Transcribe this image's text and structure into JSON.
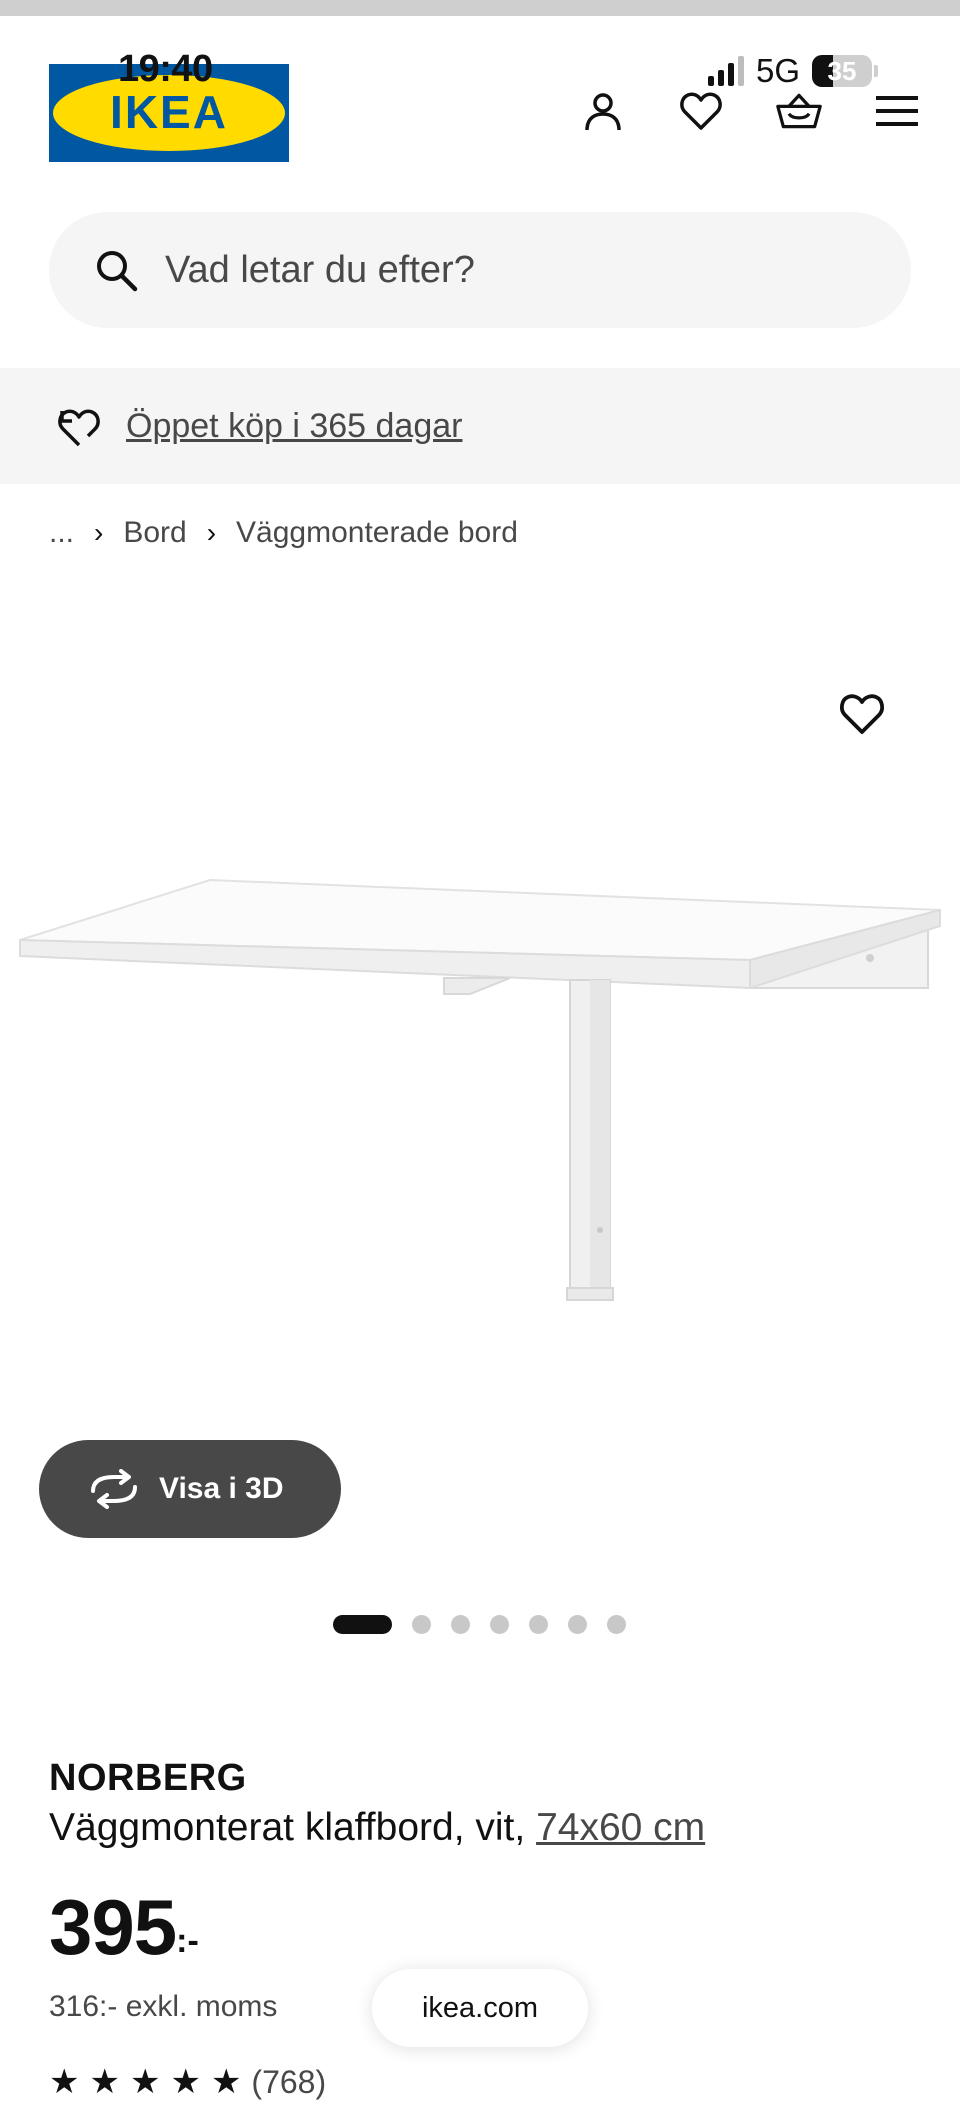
{
  "status_bar": {
    "time": "19:40",
    "network": "5G",
    "battery": "35",
    "battery_level": 35
  },
  "header": {
    "logo_text": "IKEA",
    "icons": [
      "user-icon",
      "heart-icon",
      "basket-icon",
      "menu-icon"
    ]
  },
  "search": {
    "placeholder": "Vad letar du efter?"
  },
  "promo": {
    "text": "Öppet köp i 365 dagar"
  },
  "breadcrumb": {
    "items": [
      "...",
      "Bord",
      "Väggmonterade bord"
    ]
  },
  "gallery": {
    "view_3d_label": "Visa i 3D",
    "slide_count": 7,
    "active_slide": 1
  },
  "product": {
    "name": "NORBERG",
    "description": "Väggmonterat klaffbord, vit,",
    "size": "74x60 cm",
    "price_main": "395",
    "price_suffix": ":-",
    "price_ex_vat": "316:- exkl. moms",
    "rating_count": "(768)"
  },
  "browser": {
    "url": "ikea.com"
  },
  "colors": {
    "ikea_blue": "#0058a3",
    "ikea_yellow": "#ffdb00",
    "dark_button": "#484848"
  }
}
